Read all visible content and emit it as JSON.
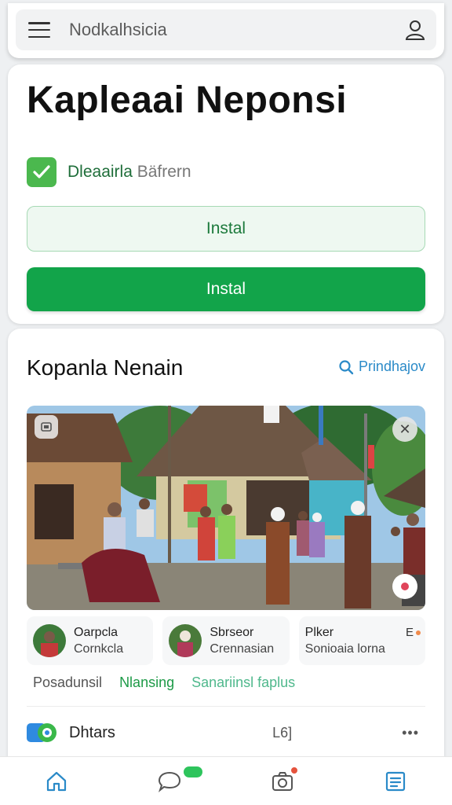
{
  "header": {
    "search_text": "Nodkalhsicia"
  },
  "install_card": {
    "title": "Kapleaai Neponsi",
    "checkbox_label_part1": "Dleaairla",
    "checkbox_label_part2": " Bäfrern",
    "checkbox_checked": true,
    "outline_button_label": "Instal",
    "primary_button_label": "Instal"
  },
  "feed": {
    "section_title": "Kopanla Nenain",
    "section_link": "Prindhajov",
    "chips": [
      {
        "line1": "Oarpcla",
        "line2": "Cornkcla"
      },
      {
        "line1": "Sbrseor",
        "line2": "Crennasian"
      },
      {
        "line1": "Plker",
        "line2": "Sonioaia lorna",
        "extra": "E"
      }
    ],
    "tabs": [
      "Posadunsil",
      "Nlansing",
      "Sanariinsl faplus"
    ],
    "list_item": {
      "label": "Dhtars",
      "count": "L6]",
      "more": "•••"
    }
  },
  "colors": {
    "accent_green": "#12a44a",
    "link_blue": "#2a8ac8",
    "checkbox_green": "#4bb84e"
  },
  "bottom_nav": [
    "home-icon",
    "chat-icon",
    "camera-icon",
    "list-icon"
  ]
}
